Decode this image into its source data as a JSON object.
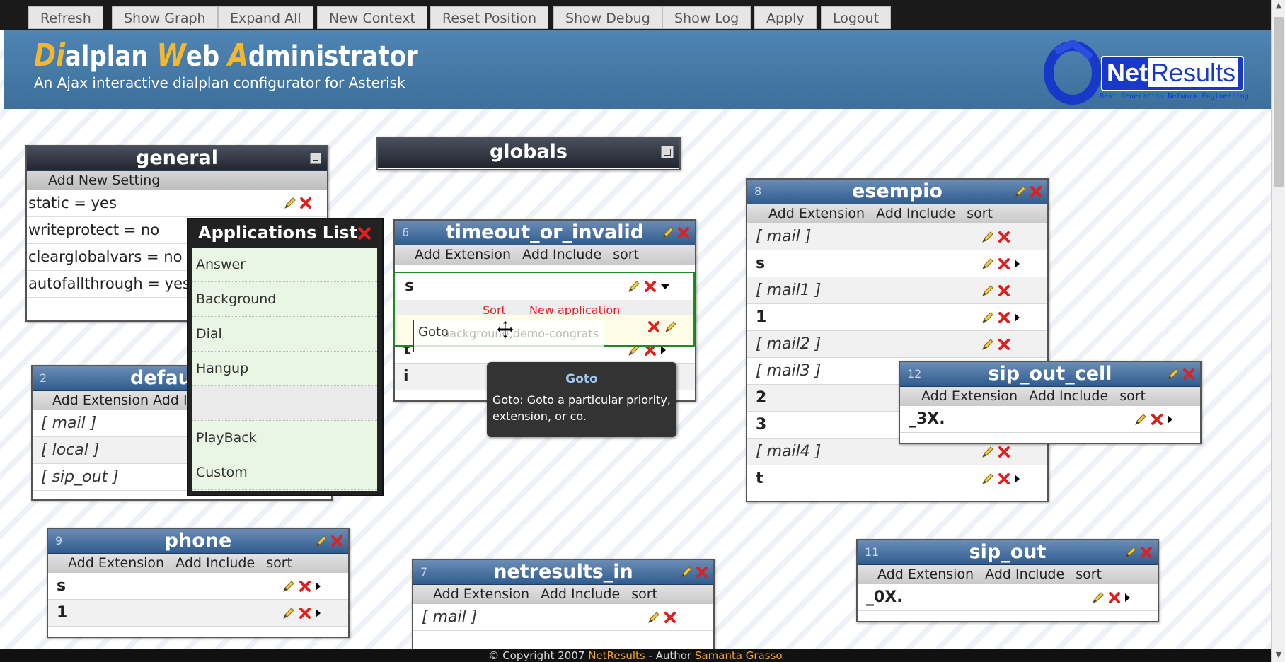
{
  "toolbar": {
    "buttons": [
      "Refresh",
      "Show Graph",
      "Expand All",
      "New Context",
      "Reset Position",
      "Show Debug",
      "Show Log",
      "Apply",
      "Logout"
    ]
  },
  "header": {
    "title_parts": [
      {
        "cap": "Di",
        "rest": "alplan "
      },
      {
        "cap": "W",
        "rest": "eb "
      },
      {
        "cap": "A",
        "rest": "dministrator"
      }
    ],
    "subtitle": "An Ajax interactive dialplan configurator for Asterisk",
    "logo": {
      "net": "Net",
      "results": "Results",
      "tagline": "Next Generation Network Engineering"
    }
  },
  "general": {
    "title": "general",
    "action": "Add New Setting",
    "settings": [
      "static = yes",
      "writeprotect = no",
      "clearglobalvars = no",
      "autofallthrough = yes"
    ]
  },
  "globals": {
    "title": "globals"
  },
  "actions": {
    "add_extension": "Add Extension",
    "add_include": "Add Include",
    "sort": "sort"
  },
  "timeout_or_invalid": {
    "num": "6",
    "title": "timeout_or_invalid",
    "rows": [
      "s",
      "t",
      "i"
    ],
    "sub_actions": {
      "sort": "Sort",
      "new_app": "New application"
    },
    "app_label": "Goto",
    "app_value": "background,demo-congrats"
  },
  "default_ctx": {
    "num": "2",
    "title": "defau",
    "actions_text": "Add Extension   Add In",
    "rows": [
      "[ mail ]",
      "[ local ]",
      "[ sip_out ]"
    ]
  },
  "esempio": {
    "num": "8",
    "title": "esempio",
    "rows": [
      {
        "text": "[ mail ]",
        "type": "inc"
      },
      {
        "text": "s",
        "type": "ext"
      },
      {
        "text": "[ mail1 ]",
        "type": "inc"
      },
      {
        "text": "1",
        "type": "ext"
      },
      {
        "text": "[ mail2 ]",
        "type": "inc"
      },
      {
        "text": "[ mail3 ]",
        "type": "inc"
      },
      {
        "text": "2",
        "type": "ext"
      },
      {
        "text": "3",
        "type": "ext"
      },
      {
        "text": "[ mail4 ]",
        "type": "inc"
      },
      {
        "text": "t",
        "type": "ext"
      }
    ]
  },
  "sip_out_cell": {
    "num": "12",
    "title": "sip_out_cell",
    "rows": [
      "_3X."
    ]
  },
  "phone": {
    "num": "9",
    "title": "phone",
    "rows": [
      "s",
      "1"
    ]
  },
  "netresults_in": {
    "num": "7",
    "title": "netresults_in",
    "rows": [
      "[ mail ]"
    ]
  },
  "sip_out": {
    "num": "11",
    "title": "sip_out",
    "rows": [
      "_0X."
    ]
  },
  "apps_list": {
    "title": "Applications List",
    "items": [
      "Answer",
      "Background",
      "Dial",
      "Hangup",
      "",
      "PlayBack",
      "Custom"
    ]
  },
  "tooltip": {
    "title": "Goto",
    "body": "Goto: Goto a particular priority, extension, or co."
  },
  "footer": {
    "copyright": "© Copyright 2007 ",
    "company": "NetResults",
    "author_prefix": " - Author ",
    "author": "Samanta Grasso"
  },
  "colors": {
    "accent": "#f3b830",
    "header": "#3d6f9b",
    "delete": "#e02020",
    "selection": "#1f8b1f"
  }
}
